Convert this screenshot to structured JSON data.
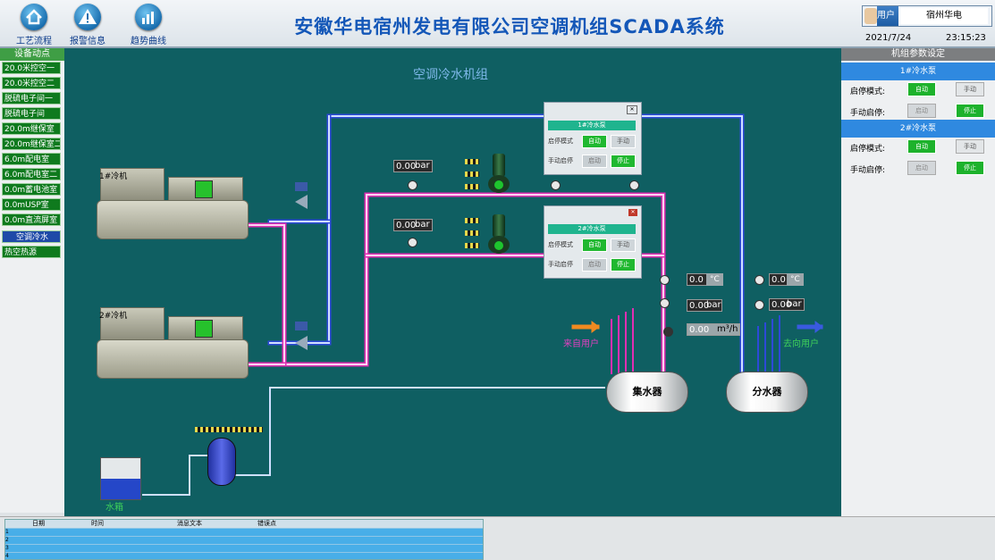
{
  "header": {
    "title": "安徽华电宿州发电有限公司空调机组SCADA系统",
    "nav": [
      {
        "label": "工艺流程",
        "icon": "home-icon"
      },
      {
        "label": "报警信息",
        "icon": "warning-icon"
      },
      {
        "label": "趋势曲线",
        "icon": "chart-icon"
      }
    ],
    "user_label": "用户",
    "user_name": "宿州华电",
    "date": "2021/7/24",
    "time": "23:15:23"
  },
  "left_panel": {
    "title": "设备动点",
    "items": [
      "20.0米控空一",
      "20.0米控空二",
      "脱硫电子间一",
      "脱硫电子间",
      "20.0m继保室",
      "20.0m继保室二",
      "6.0m配电室",
      "6.0m配电室二",
      "0.0m蓄电池室",
      "0.0mUSP室",
      "0.0m直流屏室",
      "空调冷水",
      "热空热源"
    ],
    "active_index": 11
  },
  "canvas": {
    "title": "空调冷水机组",
    "chillers": [
      {
        "label": "1#冷机"
      },
      {
        "label": "2#冷机"
      }
    ],
    "gauges": {
      "pump1_pressure": "0.00",
      "pump2_pressure": "0.00",
      "supply_temp": "0.0",
      "supply_pressure": "0.00",
      "flow": "0.00",
      "return_temp": "0.0",
      "return_pressure": "0.00"
    },
    "units": {
      "bar": "bar",
      "celsius": "°C",
      "flow": "m³/h"
    },
    "popups": [
      {
        "title": "1#冷水泵",
        "mode_label": "启停模式",
        "manual_label": "手动启停",
        "auto": "自动",
        "manual": "手动",
        "stop": "启动",
        "start": "停止"
      },
      {
        "title": "2#冷水泵",
        "mode_label": "启停模式",
        "manual_label": "手动启停",
        "auto": "自动",
        "manual": "手动",
        "stop": "启动",
        "start": "停止"
      }
    ],
    "from_user": "来自用户",
    "to_user": "去向用户",
    "collector": "集水器",
    "distributor": "分水器",
    "water_tank": "水箱"
  },
  "right_panel": {
    "title": "机组参数设定",
    "sections": [
      {
        "title": "1#冷水泵",
        "mode_label": "启停模式:",
        "manual_label": "手动启停:",
        "auto": "自动",
        "manual": "手动",
        "stop": "启动",
        "start": "停止"
      },
      {
        "title": "2#冷水泵",
        "mode_label": "启停模式:",
        "manual_label": "手动启停:",
        "auto": "自动",
        "manual": "手动",
        "stop": "启动",
        "start": "停止"
      }
    ]
  },
  "alarm_table": {
    "headers": [
      "日期",
      "时间",
      "消息文本",
      "错误点"
    ],
    "rows": [
      "1",
      "2",
      "3",
      "4"
    ]
  }
}
